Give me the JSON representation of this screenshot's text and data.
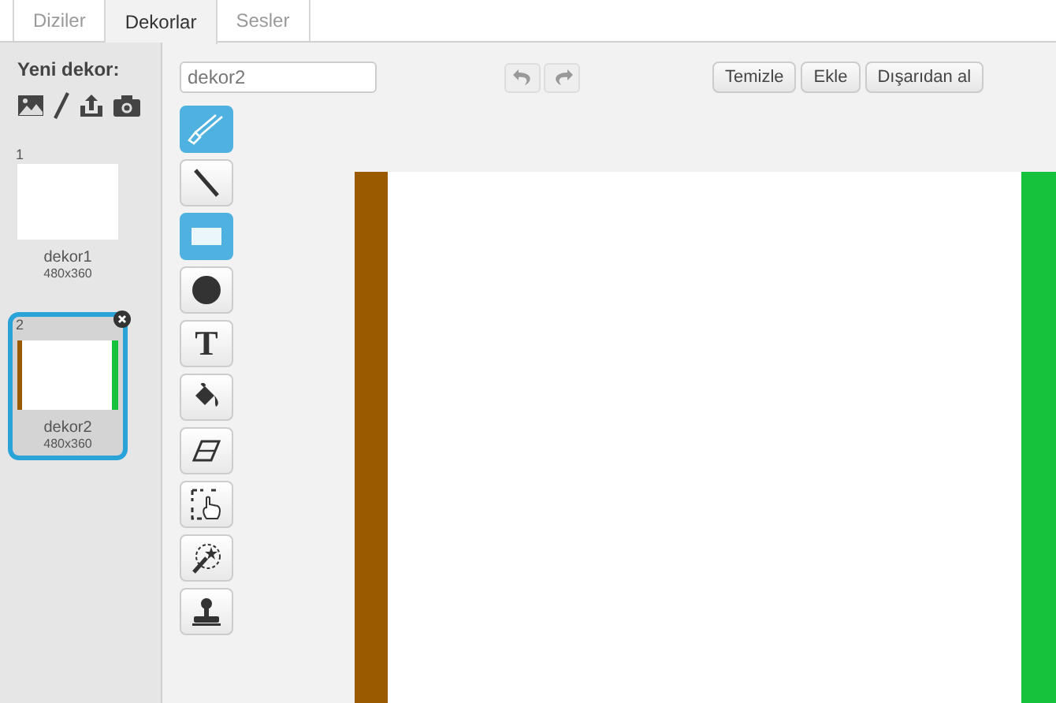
{
  "tabs": [
    {
      "label": "Diziler",
      "selected": false
    },
    {
      "label": "Dekorlar",
      "selected": true
    },
    {
      "label": "Sesler",
      "selected": false
    }
  ],
  "sidebar": {
    "title": "Yeni dekor:",
    "costumes": [
      {
        "number": "1",
        "name": "dekor1",
        "size": "480x360",
        "selected": false,
        "kind": "blank"
      },
      {
        "number": "2",
        "name": "dekor2",
        "size": "480x360",
        "selected": true,
        "kind": "striped"
      }
    ]
  },
  "editor": {
    "name_field": {
      "value": "dekor2"
    },
    "buttons": [
      "Temizle",
      "Ekle",
      "Dışarıdan al"
    ],
    "tools": [
      {
        "kind": "brush",
        "selected": true
      },
      {
        "kind": "line",
        "selected": false
      },
      {
        "kind": "rectangle",
        "selected": true
      },
      {
        "kind": "ellipse",
        "selected": false
      },
      {
        "kind": "text",
        "label": "T",
        "selected": false
      },
      {
        "kind": "fill",
        "selected": false
      },
      {
        "kind": "eraser",
        "selected": false
      },
      {
        "kind": "select",
        "selected": false
      },
      {
        "kind": "wand",
        "selected": false
      },
      {
        "kind": "stamp",
        "selected": false
      }
    ]
  }
}
